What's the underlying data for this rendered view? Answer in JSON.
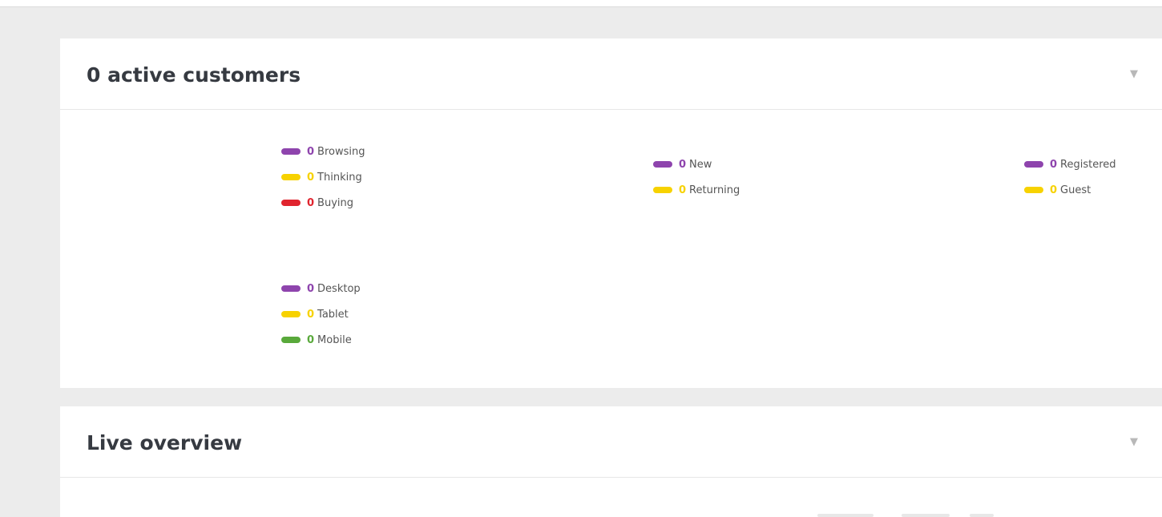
{
  "colors": {
    "purple": "#8e44ad",
    "yellow": "#f7d200",
    "red": "#e0242e",
    "green": "#59a93b",
    "background": "#ececec",
    "panel": "#ffffff"
  },
  "active_customers": {
    "title": "0 active customers",
    "toggle_icon": "triangle-down-icon",
    "toggle_glyph": "▼",
    "state_legend": [
      {
        "count": "0",
        "label": "Browsing",
        "color": "#8e44ad"
      },
      {
        "count": "0",
        "label": "Thinking",
        "color": "#f7d200"
      },
      {
        "count": "0",
        "label": "Buying",
        "color": "#e0242e"
      }
    ],
    "newness_legend": [
      {
        "count": "0",
        "label": "New",
        "color": "#8e44ad"
      },
      {
        "count": "0",
        "label": "Returning",
        "color": "#f7d200"
      }
    ],
    "registration_legend": [
      {
        "count": "0",
        "label": "Registered",
        "color": "#8e44ad"
      },
      {
        "count": "0",
        "label": "Guest",
        "color": "#f7d200"
      }
    ],
    "device_legend": [
      {
        "count": "0",
        "label": "Desktop",
        "color": "#8e44ad"
      },
      {
        "count": "0",
        "label": "Tablet",
        "color": "#f7d200"
      },
      {
        "count": "0",
        "label": "Mobile",
        "color": "#59a93b"
      }
    ]
  },
  "live_overview": {
    "title": "Live overview",
    "toggle_icon": "triangle-down-icon",
    "toggle_glyph": "▼"
  }
}
